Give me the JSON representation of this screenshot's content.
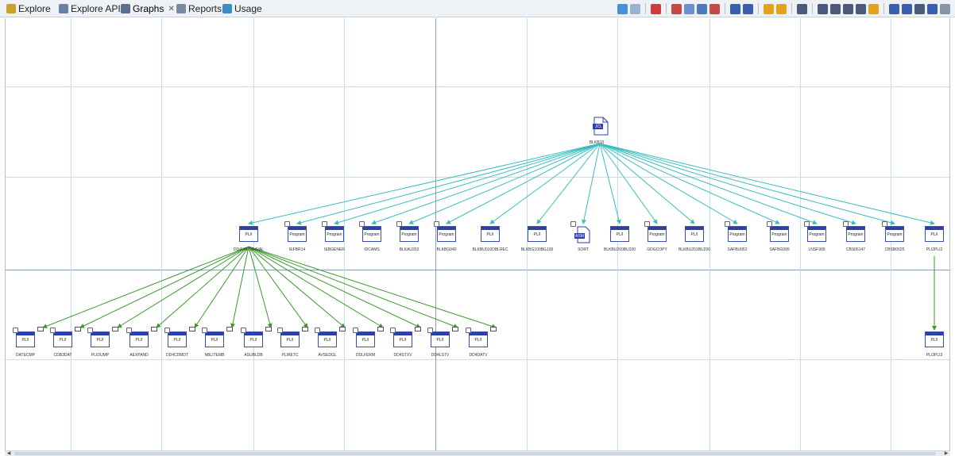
{
  "tabs": [
    {
      "name": "tab-explore",
      "label": "Explore",
      "color": "#c9a227",
      "active": false,
      "closable": false
    },
    {
      "name": "tab-explore-apis",
      "label": "Explore APIs",
      "color": "#6b7fa8",
      "active": false,
      "closable": false
    },
    {
      "name": "tab-graphs",
      "label": "Graphs",
      "color": "#5a6f91",
      "active": true,
      "closable": true
    },
    {
      "name": "tab-reports",
      "label": "Reports",
      "color": "#7a8aa3",
      "active": false,
      "closable": false
    },
    {
      "name": "tab-usage",
      "label": "Usage",
      "color": "#3b8ec2",
      "active": false,
      "closable": false
    }
  ],
  "toolbar": {
    "icons": [
      {
        "name": "fit-graph-icon",
        "color": "#4a90d9"
      },
      {
        "name": "layout-back-icon",
        "color": "#9bb3d3"
      },
      {
        "sep": true
      },
      {
        "name": "highlight-icon",
        "color": "#d13b3b"
      },
      {
        "sep": true
      },
      {
        "name": "filter-red-icon",
        "color": "#c84848"
      },
      {
        "name": "filter-blue-icon",
        "color": "#6c8fcf"
      },
      {
        "name": "filter-mixed-icon",
        "color": "#4a7cc4"
      },
      {
        "name": "filter-remove-icon",
        "color": "#c84848"
      },
      {
        "sep": true
      },
      {
        "name": "tree-layout-icon",
        "color": "#3a5fb0"
      },
      {
        "name": "grid-layout-icon",
        "color": "#3a5fb0"
      },
      {
        "sep": true
      },
      {
        "name": "undo-icon",
        "color": "#e6a21a"
      },
      {
        "name": "redo-icon",
        "color": "#e6a21a"
      },
      {
        "sep": true
      },
      {
        "name": "select-icon",
        "color": "#4a5a7a"
      },
      {
        "sep": true
      },
      {
        "name": "pointer-icon",
        "color": "#4a5a7a"
      },
      {
        "name": "pan-hand-icon",
        "color": "#4a5a7a"
      },
      {
        "name": "zoom-area-icon",
        "color": "#4a5a7a"
      },
      {
        "name": "zoom-in-icon",
        "color": "#4a5a7a"
      },
      {
        "name": "zoom-fit-icon",
        "color": "#e6a21a"
      },
      {
        "sep": true
      },
      {
        "name": "connect-icon",
        "color": "#3a5fb0"
      },
      {
        "name": "export-icon",
        "color": "#3a5fb0"
      },
      {
        "name": "settings-icon",
        "color": "#4a5a7a"
      },
      {
        "name": "print-icon",
        "color": "#3a5fb0"
      },
      {
        "name": "view-menu-icon",
        "color": "#8893a6"
      }
    ]
  },
  "graph": {
    "root": {
      "label": "BLKB10",
      "icon_text": "JCL"
    },
    "level1": [
      {
        "label": "DD4VALDD4VAL",
        "type": "PL/I",
        "lock": false
      },
      {
        "label": "IEFBR14",
        "type": "Program",
        "lock": true
      },
      {
        "label": "IEBGENER",
        "type": "Program",
        "lock": true
      },
      {
        "label": "IDCAMS",
        "type": "Program",
        "lock": true
      },
      {
        "label": "BLKAU202",
        "type": "Program",
        "lock": true
      },
      {
        "label": "BLKBG040",
        "type": "Program",
        "lock": true
      },
      {
        "label": "BLKBU010DBLREC",
        "type": "PL/I",
        "lock": false
      },
      {
        "label": "BLKBG100BG100",
        "type": "PL/I",
        "lock": false
      },
      {
        "label": "SORT",
        "type": "ASM",
        "lock": true
      },
      {
        "label": "BLKBU200BU200",
        "type": "PL/I",
        "lock": false
      },
      {
        "label": "GDGCOPY",
        "type": "Program",
        "lock": true
      },
      {
        "label": "BLKBU201BU200",
        "type": "PL/I",
        "lock": false
      },
      {
        "label": "SAFBU052",
        "type": "Program",
        "lock": true
      },
      {
        "label": "SAFBG999",
        "type": "Program",
        "lock": true
      },
      {
        "label": "LNSF999",
        "type": "Program",
        "lock": true
      },
      {
        "label": "CBS06147",
        "type": "Program",
        "lock": true
      },
      {
        "label": "CBSB0025",
        "type": "Program",
        "lock": true
      },
      {
        "label": "PLI2PLI2",
        "type": "PL/I",
        "lock": false
      }
    ],
    "level2": [
      {
        "label": "DATECMP",
        "type": "PL/I"
      },
      {
        "label": "CDB3DAT",
        "type": "PL/I"
      },
      {
        "label": "PLIDUMP",
        "type": "PL/I"
      },
      {
        "label": "AEXPAND",
        "type": "PL/I"
      },
      {
        "label": "DD4CDMDT",
        "type": "PL/I"
      },
      {
        "label": "NBLITEMB",
        "type": "PL/I"
      },
      {
        "label": "ASUBLDB",
        "type": "PL/I"
      },
      {
        "label": "PLIRETC",
        "type": "PL/I"
      },
      {
        "label": "AVSEDGL",
        "type": "PL/I"
      },
      {
        "label": "DDLFERM",
        "type": "PL/I"
      },
      {
        "label": "DD4STXV",
        "type": "PL/I"
      },
      {
        "label": "DD4LSTV",
        "type": "PL/I"
      },
      {
        "label": "DD4DATV",
        "type": "PL/I"
      }
    ],
    "leaf": {
      "label": "PLI3PLI3",
      "type": "PL/I"
    },
    "colors": {
      "edge_root": "#3bbcbf",
      "edge_green": "#3a9a2a",
      "node_border": "#2f3fa8"
    }
  },
  "scrollbar": {
    "left_arrow": "◀",
    "right_arrow": "▶"
  }
}
